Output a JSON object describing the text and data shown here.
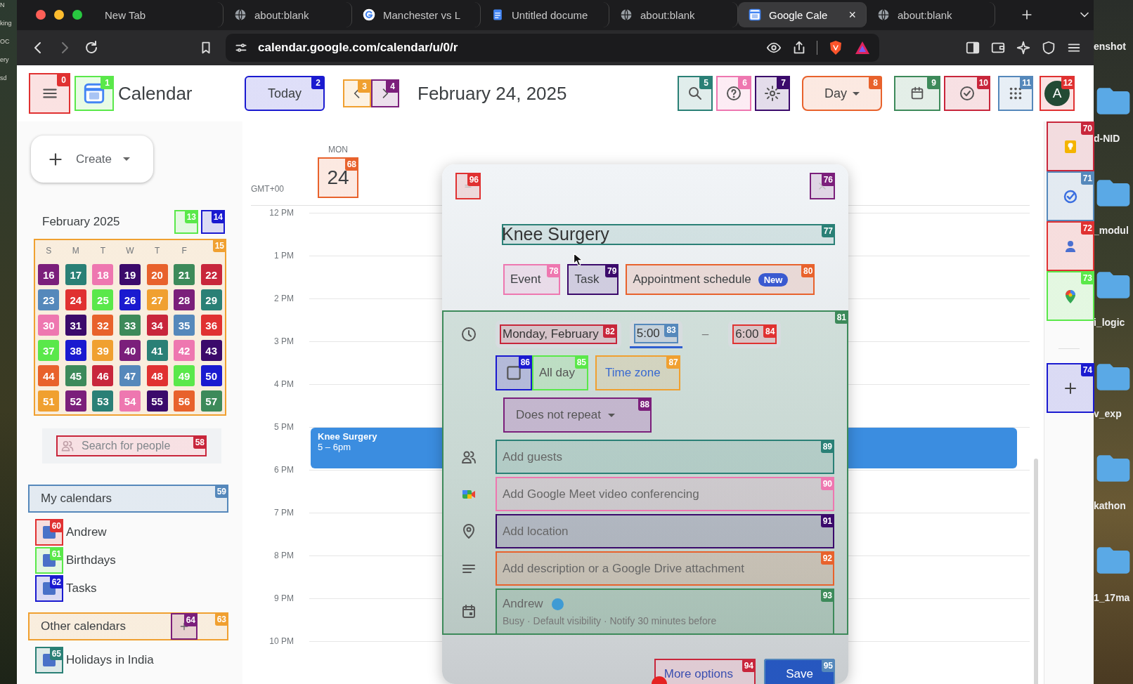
{
  "desktop": {
    "left_labels": [
      "N",
      "king",
      "OC",
      "ery",
      "sd"
    ],
    "right_labels": [
      "enshot",
      "d-NID",
      "_modul",
      "i_logic",
      "v_exp",
      "kathon",
      "1_17ma"
    ]
  },
  "browser": {
    "tabs": [
      {
        "title": "New Tab",
        "kind": "plain",
        "selected": false
      },
      {
        "title": "about:blank",
        "kind": "blank",
        "selected": false
      },
      {
        "title": "Manchester vs L",
        "kind": "search",
        "selected": false
      },
      {
        "title": "Untitled docume",
        "kind": "document",
        "selected": false
      },
      {
        "title": "about:blank",
        "kind": "blank",
        "selected": false
      },
      {
        "title": "Google Cale",
        "kind": "calendar",
        "selected": true,
        "close": "×"
      },
      {
        "title": "about:blank",
        "kind": "blank",
        "selected": false
      }
    ],
    "url": "calendar.google.com/calendar/u/0/r"
  },
  "header": {
    "menu": {
      "mark": {
        "label": "0",
        "color": "#e03131"
      }
    },
    "logo": {
      "mark": {
        "label": "1",
        "color": "#5ae84a"
      }
    },
    "app_name": "Calendar",
    "today": {
      "label": "Today",
      "mark": {
        "label": "2",
        "color": "#1a1ad0"
      }
    },
    "prev": {
      "mark": {
        "label": "3",
        "color": "#f0a030"
      }
    },
    "next": {
      "mark": {
        "label": "4",
        "color": "#7b1f7b"
      }
    },
    "date": "February 24, 2025",
    "actions": [
      {
        "kind": "search",
        "mark": {
          "label": "5",
          "color": "#2a8076"
        }
      },
      {
        "kind": "help",
        "mark": {
          "label": "6",
          "color": "#ee77b0"
        }
      },
      {
        "kind": "settings",
        "mark": {
          "label": "7",
          "color": "#3b0a6b"
        }
      },
      {
        "kind": "view_select",
        "label": "Day",
        "mark": {
          "label": "8",
          "color": "#e8622c"
        }
      },
      {
        "kind": "calendar_view",
        "mark": {
          "label": "9",
          "color": "#3d8a5a"
        }
      },
      {
        "kind": "tasks",
        "mark": {
          "label": "10",
          "color": "#c8263b"
        }
      },
      {
        "kind": "apps",
        "mark": {
          "label": "11",
          "color": "#5588bb"
        }
      },
      {
        "kind": "avatar",
        "label": "A",
        "mark": {
          "label": "12",
          "color": "#e03131"
        }
      }
    ]
  },
  "sidebar": {
    "create": {
      "label": "Create"
    },
    "mini_calendar": {
      "title": "February 2025",
      "prev": {
        "mark": {
          "label": "13",
          "color": "#5ae84a"
        }
      },
      "next": {
        "mark": {
          "label": "14",
          "color": "#1a1ad0"
        }
      },
      "mark": {
        "label": "15",
        "color": "#f0a030"
      },
      "weekdays": [
        "S",
        "M",
        "T",
        "W",
        "T",
        "F"
      ],
      "cells": [
        {
          "label": "16",
          "color": "#7b1f7b"
        },
        {
          "label": "17",
          "color": "#2a8076"
        },
        {
          "label": "18",
          "color": "#ee77b0"
        },
        {
          "label": "19",
          "color": "#3b0a6b"
        },
        {
          "label": "20",
          "color": "#e8622c"
        },
        {
          "label": "21",
          "color": "#3d8a5a"
        },
        {
          "label": "22",
          "color": "#c8263b"
        },
        {
          "label": "23",
          "color": "#5588bb"
        },
        {
          "label": "24",
          "color": "#e03131"
        },
        {
          "label": "25",
          "color": "#5ae84a"
        },
        {
          "label": "26",
          "color": "#1a1ad0"
        },
        {
          "label": "27",
          "color": "#f0a030"
        },
        {
          "label": "28",
          "color": "#7b1f7b"
        },
        {
          "label": "29",
          "color": "#2a8076"
        },
        {
          "label": "30",
          "color": "#ee77b0"
        },
        {
          "label": "31",
          "color": "#3b0a6b"
        },
        {
          "label": "32",
          "color": "#e8622c"
        },
        {
          "label": "33",
          "color": "#3d8a5a"
        },
        {
          "label": "34",
          "color": "#c8263b"
        },
        {
          "label": "35",
          "color": "#5588bb"
        },
        {
          "label": "36",
          "color": "#e03131"
        },
        {
          "label": "37",
          "color": "#5ae84a"
        },
        {
          "label": "38",
          "color": "#1a1ad0"
        },
        {
          "label": "39",
          "color": "#f0a030"
        },
        {
          "label": "40",
          "color": "#7b1f7b"
        },
        {
          "label": "41",
          "color": "#2a8076"
        },
        {
          "label": "42",
          "color": "#ee77b0"
        },
        {
          "label": "43",
          "color": "#3b0a6b"
        },
        {
          "label": "44",
          "color": "#e8622c"
        },
        {
          "label": "45",
          "color": "#3d8a5a"
        },
        {
          "label": "46",
          "color": "#c8263b"
        },
        {
          "label": "47",
          "color": "#5588bb"
        },
        {
          "label": "48",
          "color": "#e03131"
        },
        {
          "label": "49",
          "color": "#5ae84a"
        },
        {
          "label": "50",
          "color": "#1a1ad0"
        },
        {
          "label": "51",
          "color": "#f0a030"
        },
        {
          "label": "52",
          "color": "#7b1f7b"
        },
        {
          "label": "53",
          "color": "#2a8076"
        },
        {
          "label": "54",
          "color": "#ee77b0"
        },
        {
          "label": "55",
          "color": "#3b0a6b"
        },
        {
          "label": "56",
          "color": "#e8622c"
        },
        {
          "label": "57",
          "color": "#3d8a5a"
        }
      ]
    },
    "people_search": {
      "placeholder": "Search for people",
      "mark": {
        "label": "58",
        "color": "#c8263b"
      }
    },
    "my_calendars": {
      "title": "My calendars",
      "mark": {
        "label": "59",
        "color": "#5588bb"
      },
      "items": [
        {
          "name": "Andrew",
          "mark": {
            "label": "60",
            "color": "#e03131"
          }
        },
        {
          "name": "Birthdays",
          "mark": {
            "label": "61",
            "color": "#5ae84a"
          }
        },
        {
          "name": "Tasks",
          "mark": {
            "label": "62",
            "color": "#1a1ad0"
          }
        }
      ]
    },
    "other_calendars": {
      "title": "Other calendars",
      "mark": {
        "label": "63",
        "color": "#f0a030"
      },
      "add_mark": {
        "label": "64",
        "color": "#7b1f7b"
      },
      "items": [
        {
          "name": "Holidays in India",
          "mark": {
            "label": "65",
            "color": "#2a8076"
          }
        }
      ]
    }
  },
  "main": {
    "day": {
      "weekday": "MON",
      "date": "24",
      "mark": {
        "label": "68",
        "color": "#e8622c"
      }
    },
    "timezone": "GMT+00",
    "hours": [
      {
        "label": "12 PM"
      },
      {
        "label": "1 PM"
      },
      {
        "label": "2 PM"
      },
      {
        "label": "3 PM"
      },
      {
        "label": "4 PM"
      },
      {
        "label": "5 PM",
        "event": {
          "title": "Knee Surgery",
          "time": "5 – 6pm"
        }
      },
      {
        "label": "6 PM"
      },
      {
        "label": "7 PM"
      },
      {
        "label": "8 PM"
      },
      {
        "label": "9 PM"
      },
      {
        "label": "10 PM"
      }
    ]
  },
  "side_panel": {
    "items": [
      {
        "kind": "keep",
        "mark": {
          "label": "70",
          "color": "#c8263b"
        }
      },
      {
        "kind": "tasks",
        "mark": {
          "label": "71",
          "color": "#5588bb"
        }
      },
      {
        "kind": "contacts",
        "mark": {
          "label": "72",
          "color": "#e03131"
        }
      },
      {
        "kind": "maps",
        "mark": {
          "label": "73",
          "color": "#5ae84a"
        }
      },
      {
        "kind": "add",
        "mark": {
          "label": "74",
          "color": "#1a1ad0"
        }
      }
    ]
  },
  "dialog": {
    "handle_mark": {
      "label": "96",
      "color": "#e03131"
    },
    "close_mark": {
      "label": "76",
      "color": "#7b1f7b"
    },
    "title": {
      "value": "Knee Surgery",
      "mark": {
        "label": "77",
        "color": "#2a8076"
      }
    },
    "types": [
      {
        "label": "Event",
        "mark": {
          "label": "78",
          "color": "#ee77b0"
        }
      },
      {
        "label": "Task",
        "mark": {
          "label": "79",
          "color": "#3b0a6b"
        }
      },
      {
        "label": "Appointment schedule",
        "badge": "New",
        "mark": {
          "label": "80",
          "color": "#e8622c"
        }
      }
    ],
    "details_mark": {
      "label": "81",
      "color": "#3d8a5a"
    },
    "date": {
      "value": "Monday, February",
      "mark": {
        "label": "82",
        "color": "#c8263b"
      }
    },
    "start": {
      "value": "5:00",
      "mark": {
        "label": "83",
        "color": "#5588bb"
      }
    },
    "separator": "–",
    "end": {
      "value": "6:00",
      "mark": {
        "label": "84",
        "color": "#e03131"
      }
    },
    "all_day_checkbox": {
      "checked": false,
      "mark": {
        "label": "86",
        "color": "#1a1ad0"
      }
    },
    "all_day": {
      "label": "All day",
      "mark": {
        "label": "85",
        "color": "#5ae84a"
      }
    },
    "time_zone": {
      "label": "Time zone",
      "mark": {
        "label": "87",
        "color": "#f0a030"
      }
    },
    "repeat": {
      "label": "Does not repeat",
      "mark": {
        "label": "88",
        "color": "#7b1f7b"
      }
    },
    "rows": [
      {
        "kind": "guests",
        "label": "Add guests",
        "mark": {
          "label": "89",
          "color": "#2a8076"
        }
      },
      {
        "kind": "meet",
        "label": "Add Google Meet video conferencing",
        "mark": {
          "label": "90",
          "color": "#ee77b0"
        }
      },
      {
        "kind": "location",
        "label": "Add location",
        "mark": {
          "label": "91",
          "color": "#3b0a6b"
        }
      },
      {
        "kind": "description",
        "label": "Add description or a Google Drive attachment",
        "mark": {
          "label": "92",
          "color": "#e8622c"
        }
      },
      {
        "kind": "calendar",
        "label": "Andrew",
        "color": "#3f9bd4",
        "detail": "Busy · Default visibility · Notify 30 minutes before",
        "mark": {
          "label": "93",
          "color": "#3d8a5a"
        }
      }
    ],
    "more_options": {
      "label": "More options",
      "mark": {
        "label": "94",
        "color": "#c8263b"
      }
    },
    "save": {
      "label": "Save",
      "mark": {
        "label": "95",
        "color": "#5588bb"
      }
    }
  }
}
